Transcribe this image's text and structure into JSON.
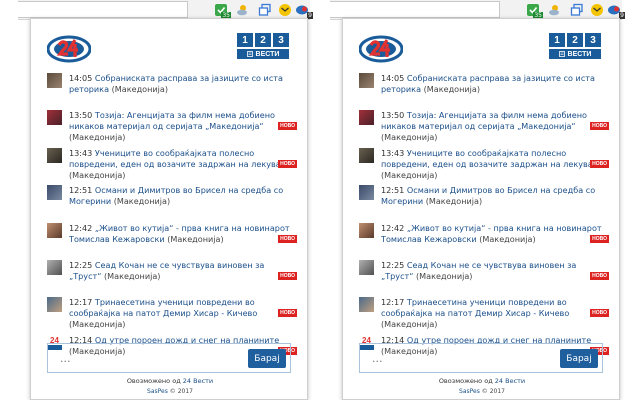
{
  "extensions": [
    {
      "name": "green-badge-icon",
      "badge": "35"
    },
    {
      "name": "weather-icon",
      "badge": ""
    },
    {
      "name": "mail-icon",
      "badge": ""
    },
    {
      "name": "news24-icon",
      "badge": "9"
    }
  ],
  "header": {
    "pills": [
      "1",
      "2",
      "3"
    ],
    "vesti_label": "ВЕСТИ"
  },
  "news": [
    {
      "time": "14:05",
      "title": "Собраниската расправа за јазиците со иста реторика",
      "region": "(Македонија)",
      "novo": ""
    },
    {
      "time": "13:50",
      "title": "Тозија: Агенцијата за филм нема добиено никаков материјал од серијата „Македонија“",
      "region": "(Македонија)",
      "novo": "НОВО"
    },
    {
      "time": "13:43",
      "title": "Учениците во сообраќајката полесно повредени, еден од возачите задржан на лекување",
      "region": "(Македонија)",
      "novo": "НОВО"
    },
    {
      "time": "12:51",
      "title": "Османи и Димитров во Брисел на средба со Могерини",
      "region": "(Македонија)",
      "novo": ""
    },
    {
      "time": "12:42",
      "title": "„Живот во кутија“ - прва книга на новинарот Томислав Кежаровски",
      "region": "(Македонија)",
      "novo": "НОВО"
    },
    {
      "time": "12:25",
      "title": "Сеад Кочан не се чувствува виновен за „Труст“",
      "region": "(Македонија)",
      "novo": "НОВО"
    },
    {
      "time": "12:17",
      "title": "Тринаесетина ученици повредени во сообраќајка на патот Демир Хисар - Кичево",
      "region": "(Македонија)",
      "novo": "НОВО"
    },
    {
      "time": "12:14",
      "title": "Од утре пороен дожд и снег на планините",
      "region": "(Македонија)",
      "novo": "НОВО"
    }
  ],
  "search": {
    "placeholder": "...",
    "button_label": "Барај"
  },
  "footer": {
    "powered_prefix": "Овозможено од",
    "powered_brand": "24 Вести",
    "copyright_brand": "SasPes",
    "copyright_suffix": "© 2017"
  },
  "colors": {
    "brand_blue": "#1a5c9a",
    "link_blue": "#1b4f8a",
    "novo_red": "#dd2222"
  }
}
